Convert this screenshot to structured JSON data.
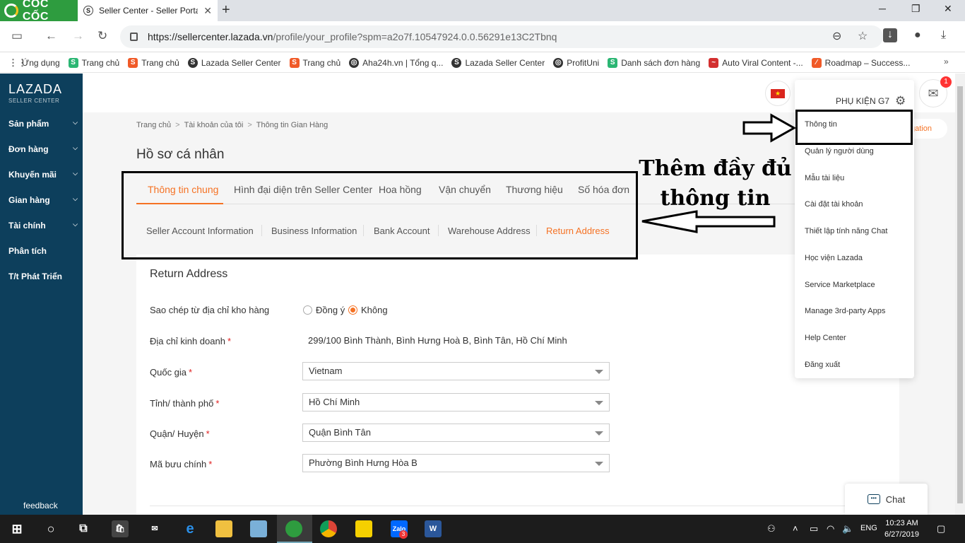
{
  "browser": {
    "brand": "CỐC CỐC",
    "tab_title": "Seller Center - Seller Portal",
    "url_host": "https://sellercenter.lazada.vn",
    "url_path": "/profile/your_profile?spm=a2o7f.10547924.0.0.56291e13C2Tbnq",
    "bookmarks": [
      {
        "label": "Ứng dụng",
        "icon": "apps-grid-icon"
      },
      {
        "label": "Trang chủ",
        "icon": "green-s-icon"
      },
      {
        "label": "Trang chủ",
        "icon": "shopee-icon"
      },
      {
        "label": "Lazada Seller Center",
        "icon": "s-circle-icon"
      },
      {
        "label": "Trang chủ",
        "icon": "shopee-icon"
      },
      {
        "label": "Aha24h.vn | Tổng q...",
        "icon": "globe-icon"
      },
      {
        "label": "Lazada Seller Center",
        "icon": "s-circle-icon"
      },
      {
        "label": "ProfitUni",
        "icon": "globe-icon"
      },
      {
        "label": "Danh sách đơn hàng",
        "icon": "green-s-icon"
      },
      {
        "label": "Auto Viral Content -...",
        "icon": "red-line-icon"
      },
      {
        "label": "Roadmap – Success...",
        "icon": "multicolor-icon"
      }
    ]
  },
  "sidebar": {
    "logo": "LAZADA",
    "logo_sub": "SELLER CENTER",
    "items": [
      {
        "label": "Sản phẩm",
        "chevron": true
      },
      {
        "label": "Đơn hàng",
        "chevron": true
      },
      {
        "label": "Khuyến mãi",
        "chevron": true
      },
      {
        "label": "Gian hàng",
        "chevron": true
      },
      {
        "label": "Tài chính",
        "chevron": true
      },
      {
        "label": "Phân tích",
        "chevron": false
      },
      {
        "label": "T/t Phát Triển",
        "chevron": false
      }
    ],
    "feedback": "feedback"
  },
  "header": {
    "shop_name": "PHỤ KIỆN G7",
    "notification_count": "1",
    "navigation_partial": "gation"
  },
  "breadcrumb": [
    "Trang chủ",
    "Tài khoản của tôi",
    "Thông tin Gian Hàng"
  ],
  "page_title": "Hồ sơ cá nhân",
  "primary_tabs": [
    "Thông tin chung",
    "Hình đại diện trên Seller Center",
    "Hoa hồng",
    "Vận chuyển",
    "Thương hiệu",
    "Số hóa đơn"
  ],
  "secondary_tabs": [
    "Seller Account Information",
    "Business Information",
    "Bank Account",
    "Warehouse Address",
    "Return Address"
  ],
  "form": {
    "title": "Return Address",
    "copy_label": "Sao chép từ địa chỉ kho hàng",
    "copy_options": [
      "Đồng ý",
      "Không"
    ],
    "copy_selected": "Không",
    "business_address_label": "Địa chỉ kinh doanh",
    "business_address_value": "299/100 Bình Thành, Bình Hưng Hoà B, Bình Tân, Hồ Chí Minh",
    "country_label": "Quốc gia",
    "country_value": "Vietnam",
    "city_label": "Tỉnh/ thành phố",
    "city_value": "Hồ Chí Minh",
    "district_label": "Quận/ Huyện",
    "district_value": "Quận Bình Tân",
    "postal_label": "Mã bưu chính",
    "postal_value": "Phường Bình Hưng Hòa B",
    "required_mark": "*"
  },
  "dropdown_menu": [
    "Thông tin",
    "Quản lý người dùng",
    "Mẫu tài liệu",
    "Cài đặt tài khoản",
    "Thiết lập tính năng Chat",
    "Học viện Lazada",
    "Service Marketplace",
    "Manage 3rd-party Apps",
    "Help Center",
    "Đăng xuất"
  ],
  "annotation": {
    "line1": "Thêm đầy đủ",
    "line2": "thông tin"
  },
  "chat": {
    "label": "Chat"
  },
  "taskbar": {
    "language": "ENG",
    "time": "10:23 AM",
    "date": "6/27/2019",
    "zalo_badge": "3"
  },
  "colors": {
    "accent": "#f57224",
    "sidebar": "#0d3f5c",
    "browser_brand": "#2e9c3f"
  }
}
